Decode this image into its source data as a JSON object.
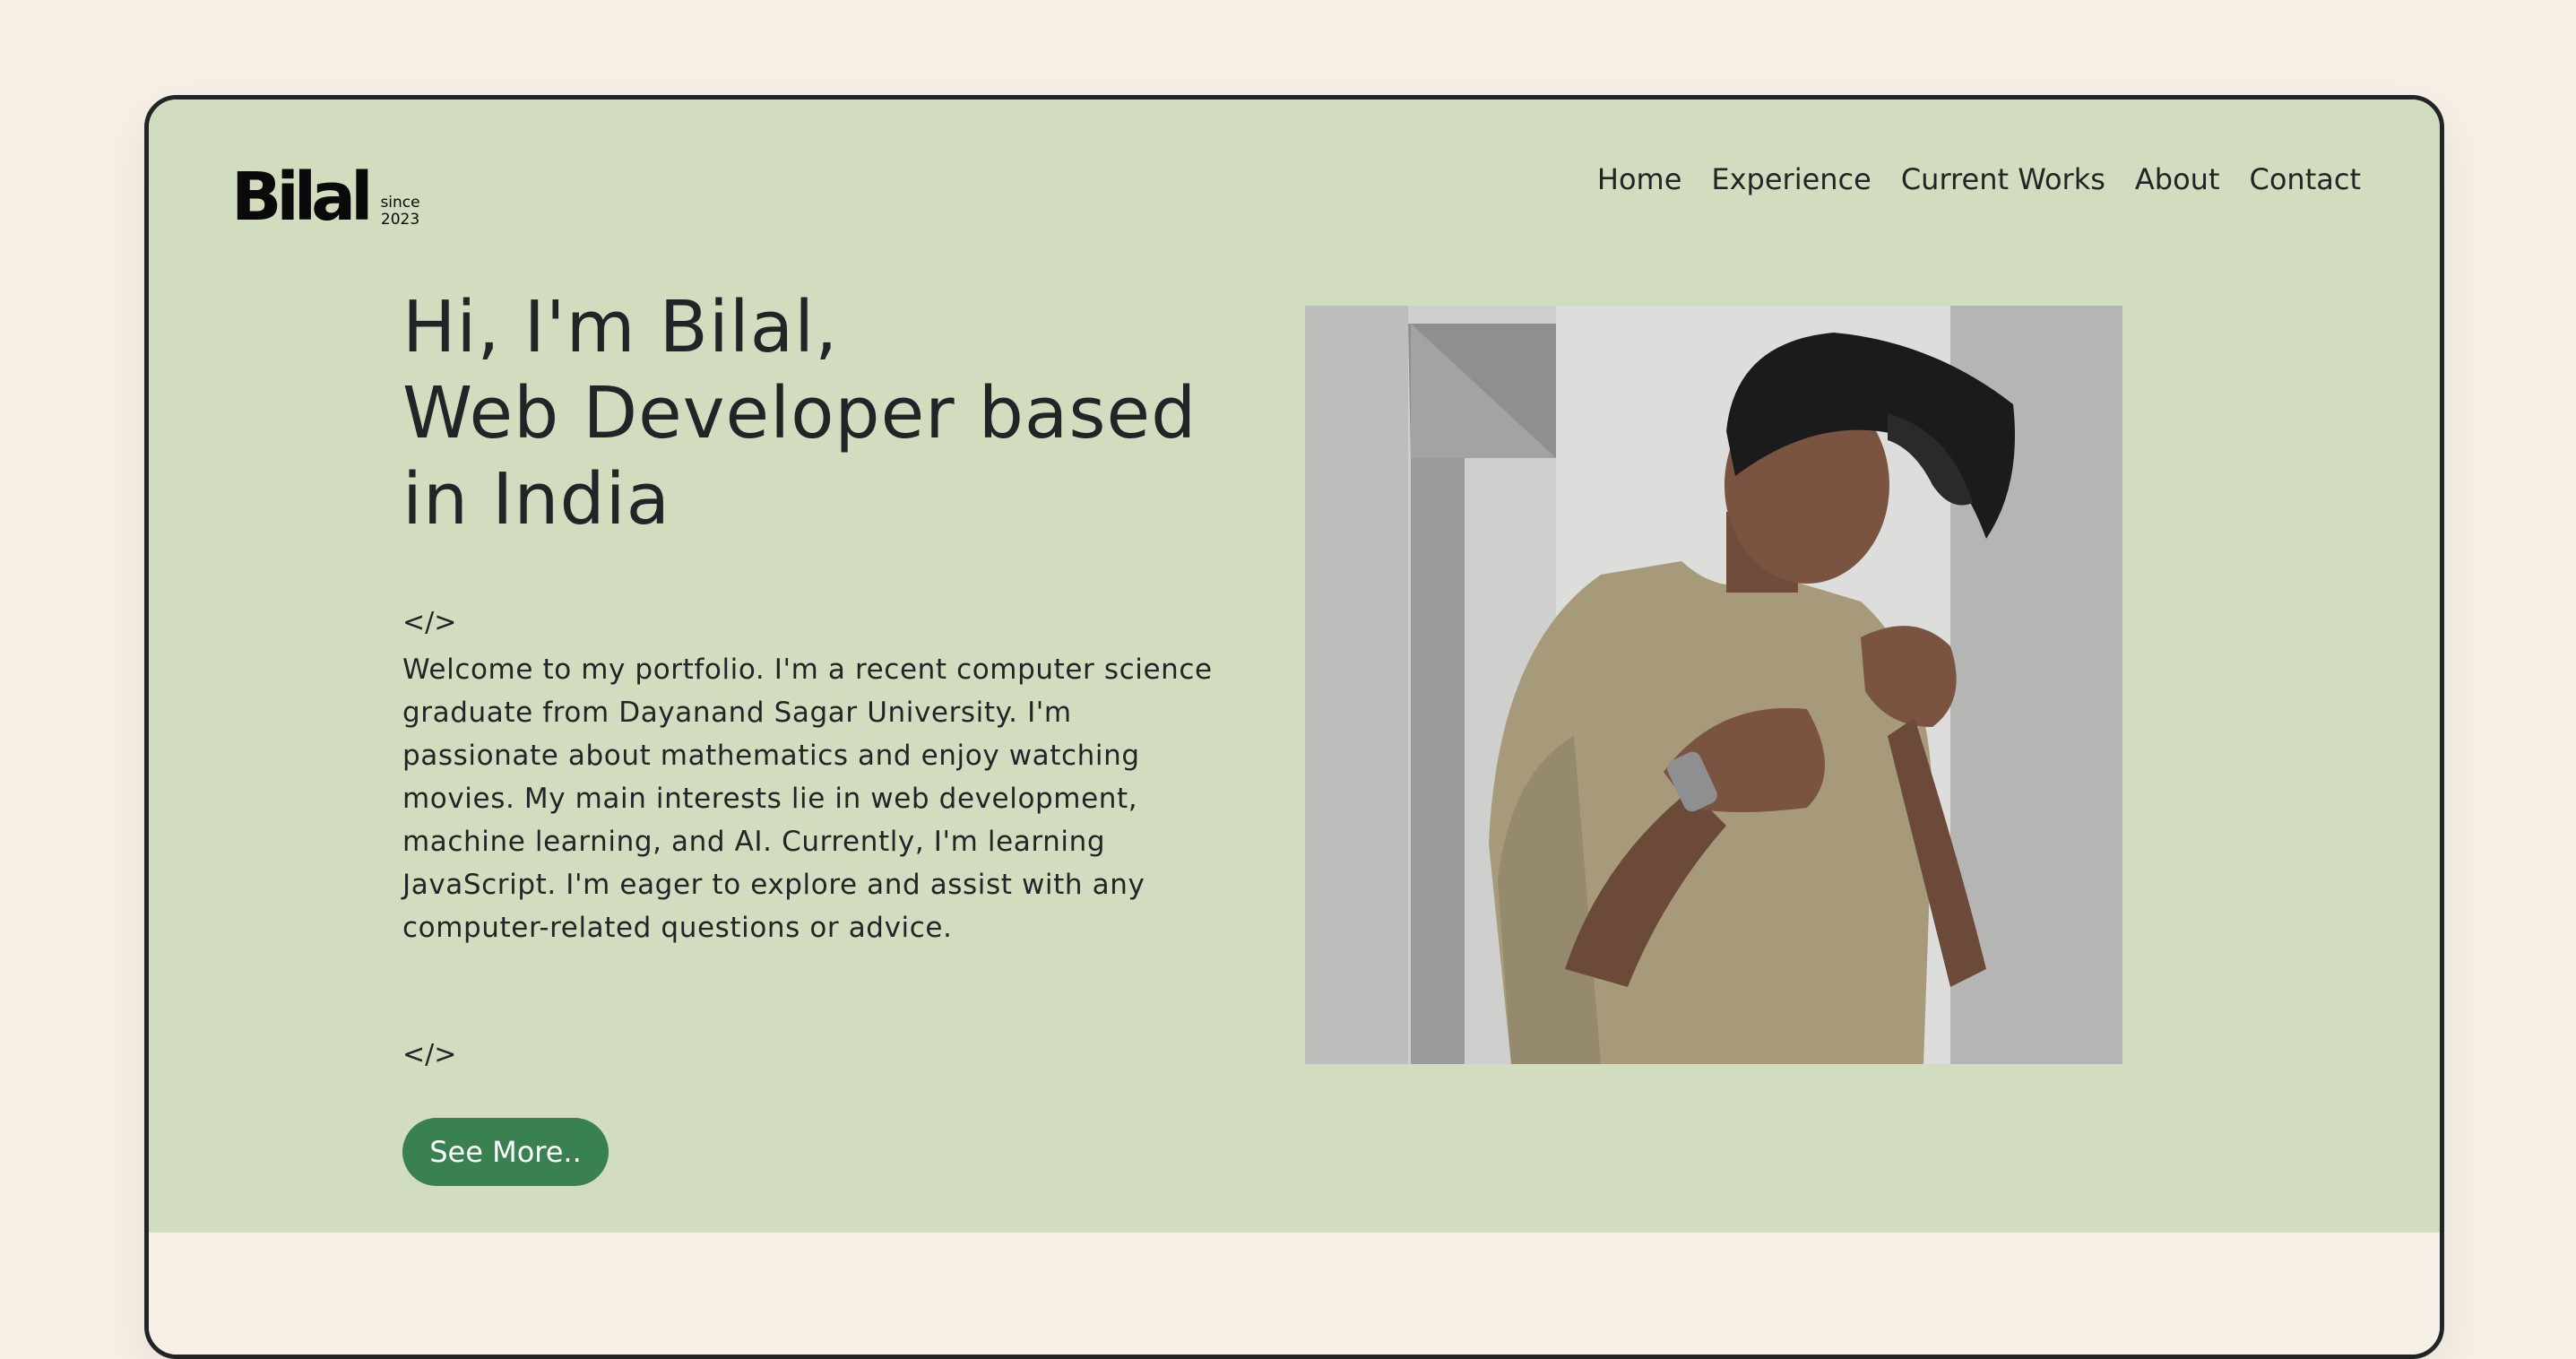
{
  "logo": {
    "name": "Bilal",
    "since_line1": "since",
    "since_line2": "2023"
  },
  "nav": {
    "items": [
      "Home",
      "Experience",
      "Current Works",
      "About",
      "Contact"
    ]
  },
  "hero": {
    "title_line1": "Hi, I'm Bilal,",
    "title_line2": "Web Developer based",
    "title_line3": "in India",
    "code_open": "</>",
    "bio": "Welcome to my portfolio. I'm a recent computer science graduate from Dayanand Sagar University. I'm passionate about mathematics and enjoy watching movies. My main interests lie in web development, machine learning, and AI. Currently, I'm learning JavaScript. I'm eager to explore and assist with any computer-related questions or advice.",
    "code_close": "</>",
    "cta_label": "See More.."
  },
  "colors": {
    "page_background": "#f7f0e6",
    "hero_background": "#d2ddbf",
    "text": "#222527",
    "cta": "#3a8152"
  }
}
